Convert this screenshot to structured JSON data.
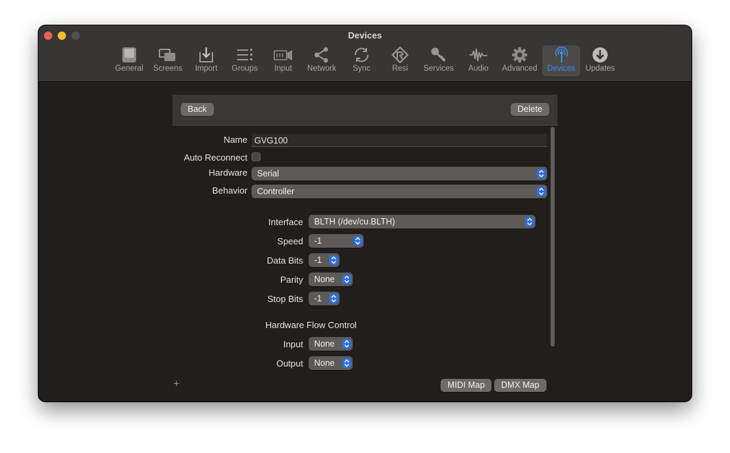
{
  "window": {
    "title": "Devices"
  },
  "toolbar": {
    "items": [
      {
        "label": "General",
        "icon": "general-icon"
      },
      {
        "label": "Screens",
        "icon": "screens-icon"
      },
      {
        "label": "Import",
        "icon": "import-icon"
      },
      {
        "label": "Groups",
        "icon": "groups-icon"
      },
      {
        "label": "Input",
        "icon": "input-icon"
      },
      {
        "label": "Network",
        "icon": "network-icon"
      },
      {
        "label": "Sync",
        "icon": "sync-icon"
      },
      {
        "label": "Resi",
        "icon": "resi-icon"
      },
      {
        "label": "Services",
        "icon": "services-icon"
      },
      {
        "label": "Audio",
        "icon": "audio-icon"
      },
      {
        "label": "Advanced",
        "icon": "advanced-icon"
      },
      {
        "label": "Devices",
        "icon": "devices-icon",
        "active": true
      },
      {
        "label": "Updates",
        "icon": "updates-icon"
      }
    ],
    "active_color": "#3b8cf0"
  },
  "header": {
    "back_label": "Back",
    "delete_label": "Delete"
  },
  "form": {
    "name_label": "Name",
    "name_value": "GVG100",
    "auto_reconnect_label": "Auto Reconnect",
    "auto_reconnect_checked": false,
    "hardware_label": "Hardware",
    "hardware_value": "Serial",
    "behavior_label": "Behavior",
    "behavior_value": "Controller",
    "interface_label": "Interface",
    "interface_value": "BLTH (/dev/cu.BLTH)",
    "speed_label": "Speed",
    "speed_value": "-1",
    "data_bits_label": "Data Bits",
    "data_bits_value": "-1",
    "parity_label": "Parity",
    "parity_value": "None",
    "stop_bits_label": "Stop Bits",
    "stop_bits_value": "-1",
    "flow_control_heading": "Hardware Flow Control",
    "input_label": "Input",
    "input_value": "None",
    "output_label": "Output",
    "output_value": "None"
  },
  "footer": {
    "add_symbol": "+",
    "midi_map_label": "MIDI Map",
    "dmx_map_label": "DMX Map"
  }
}
